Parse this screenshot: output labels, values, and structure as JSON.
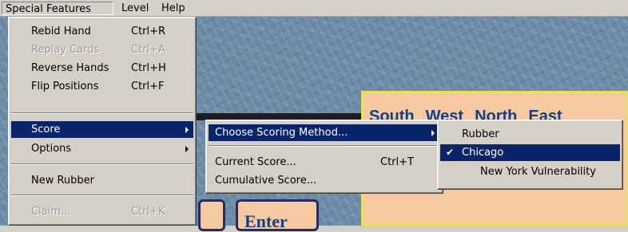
{
  "menubar": {
    "items": [
      "Special Features",
      "Level",
      "Help"
    ]
  },
  "menu": {
    "items": [
      {
        "label": "Rebid Hand",
        "shortcut": "Ctrl+R",
        "enabled": true
      },
      {
        "label": "Replay Cards",
        "shortcut": "Ctrl+A",
        "enabled": false
      },
      {
        "label": "Reverse Hands",
        "shortcut": "Ctrl+H",
        "enabled": true
      },
      {
        "label": "Flip Positions",
        "shortcut": "Ctrl+F",
        "enabled": true
      },
      {
        "label": "Score",
        "submenu": true,
        "highlighted": true
      },
      {
        "label": "Options",
        "submenu": true
      },
      {
        "label": "New Rubber"
      },
      {
        "label": "Claim...",
        "shortcut": "Ctrl+K",
        "enabled": false
      }
    ]
  },
  "score_submenu": {
    "items": [
      {
        "label": "Choose Scoring Method...",
        "submenu": true,
        "highlighted": true
      },
      {
        "label": "Current Score...",
        "shortcut": "Ctrl+T"
      },
      {
        "label": "Cumulative Score..."
      }
    ]
  },
  "method_submenu": {
    "items": [
      {
        "label": "Rubber",
        "checked": false
      },
      {
        "label": "Chicago",
        "checked": true,
        "highlighted": true
      },
      {
        "label": "New York Vulnerability",
        "checked": false
      }
    ]
  },
  "bid_panel": {
    "headers": [
      "South",
      "West",
      "North",
      "East"
    ]
  },
  "enter_button": {
    "label": "Enter"
  },
  "colors": {
    "highlight": "#0a246a",
    "menu_bg": "#d4d0c8",
    "panel_bg": "#f7c9a1",
    "panel_text": "#123e8c",
    "desktop": "#6b8aa6"
  }
}
